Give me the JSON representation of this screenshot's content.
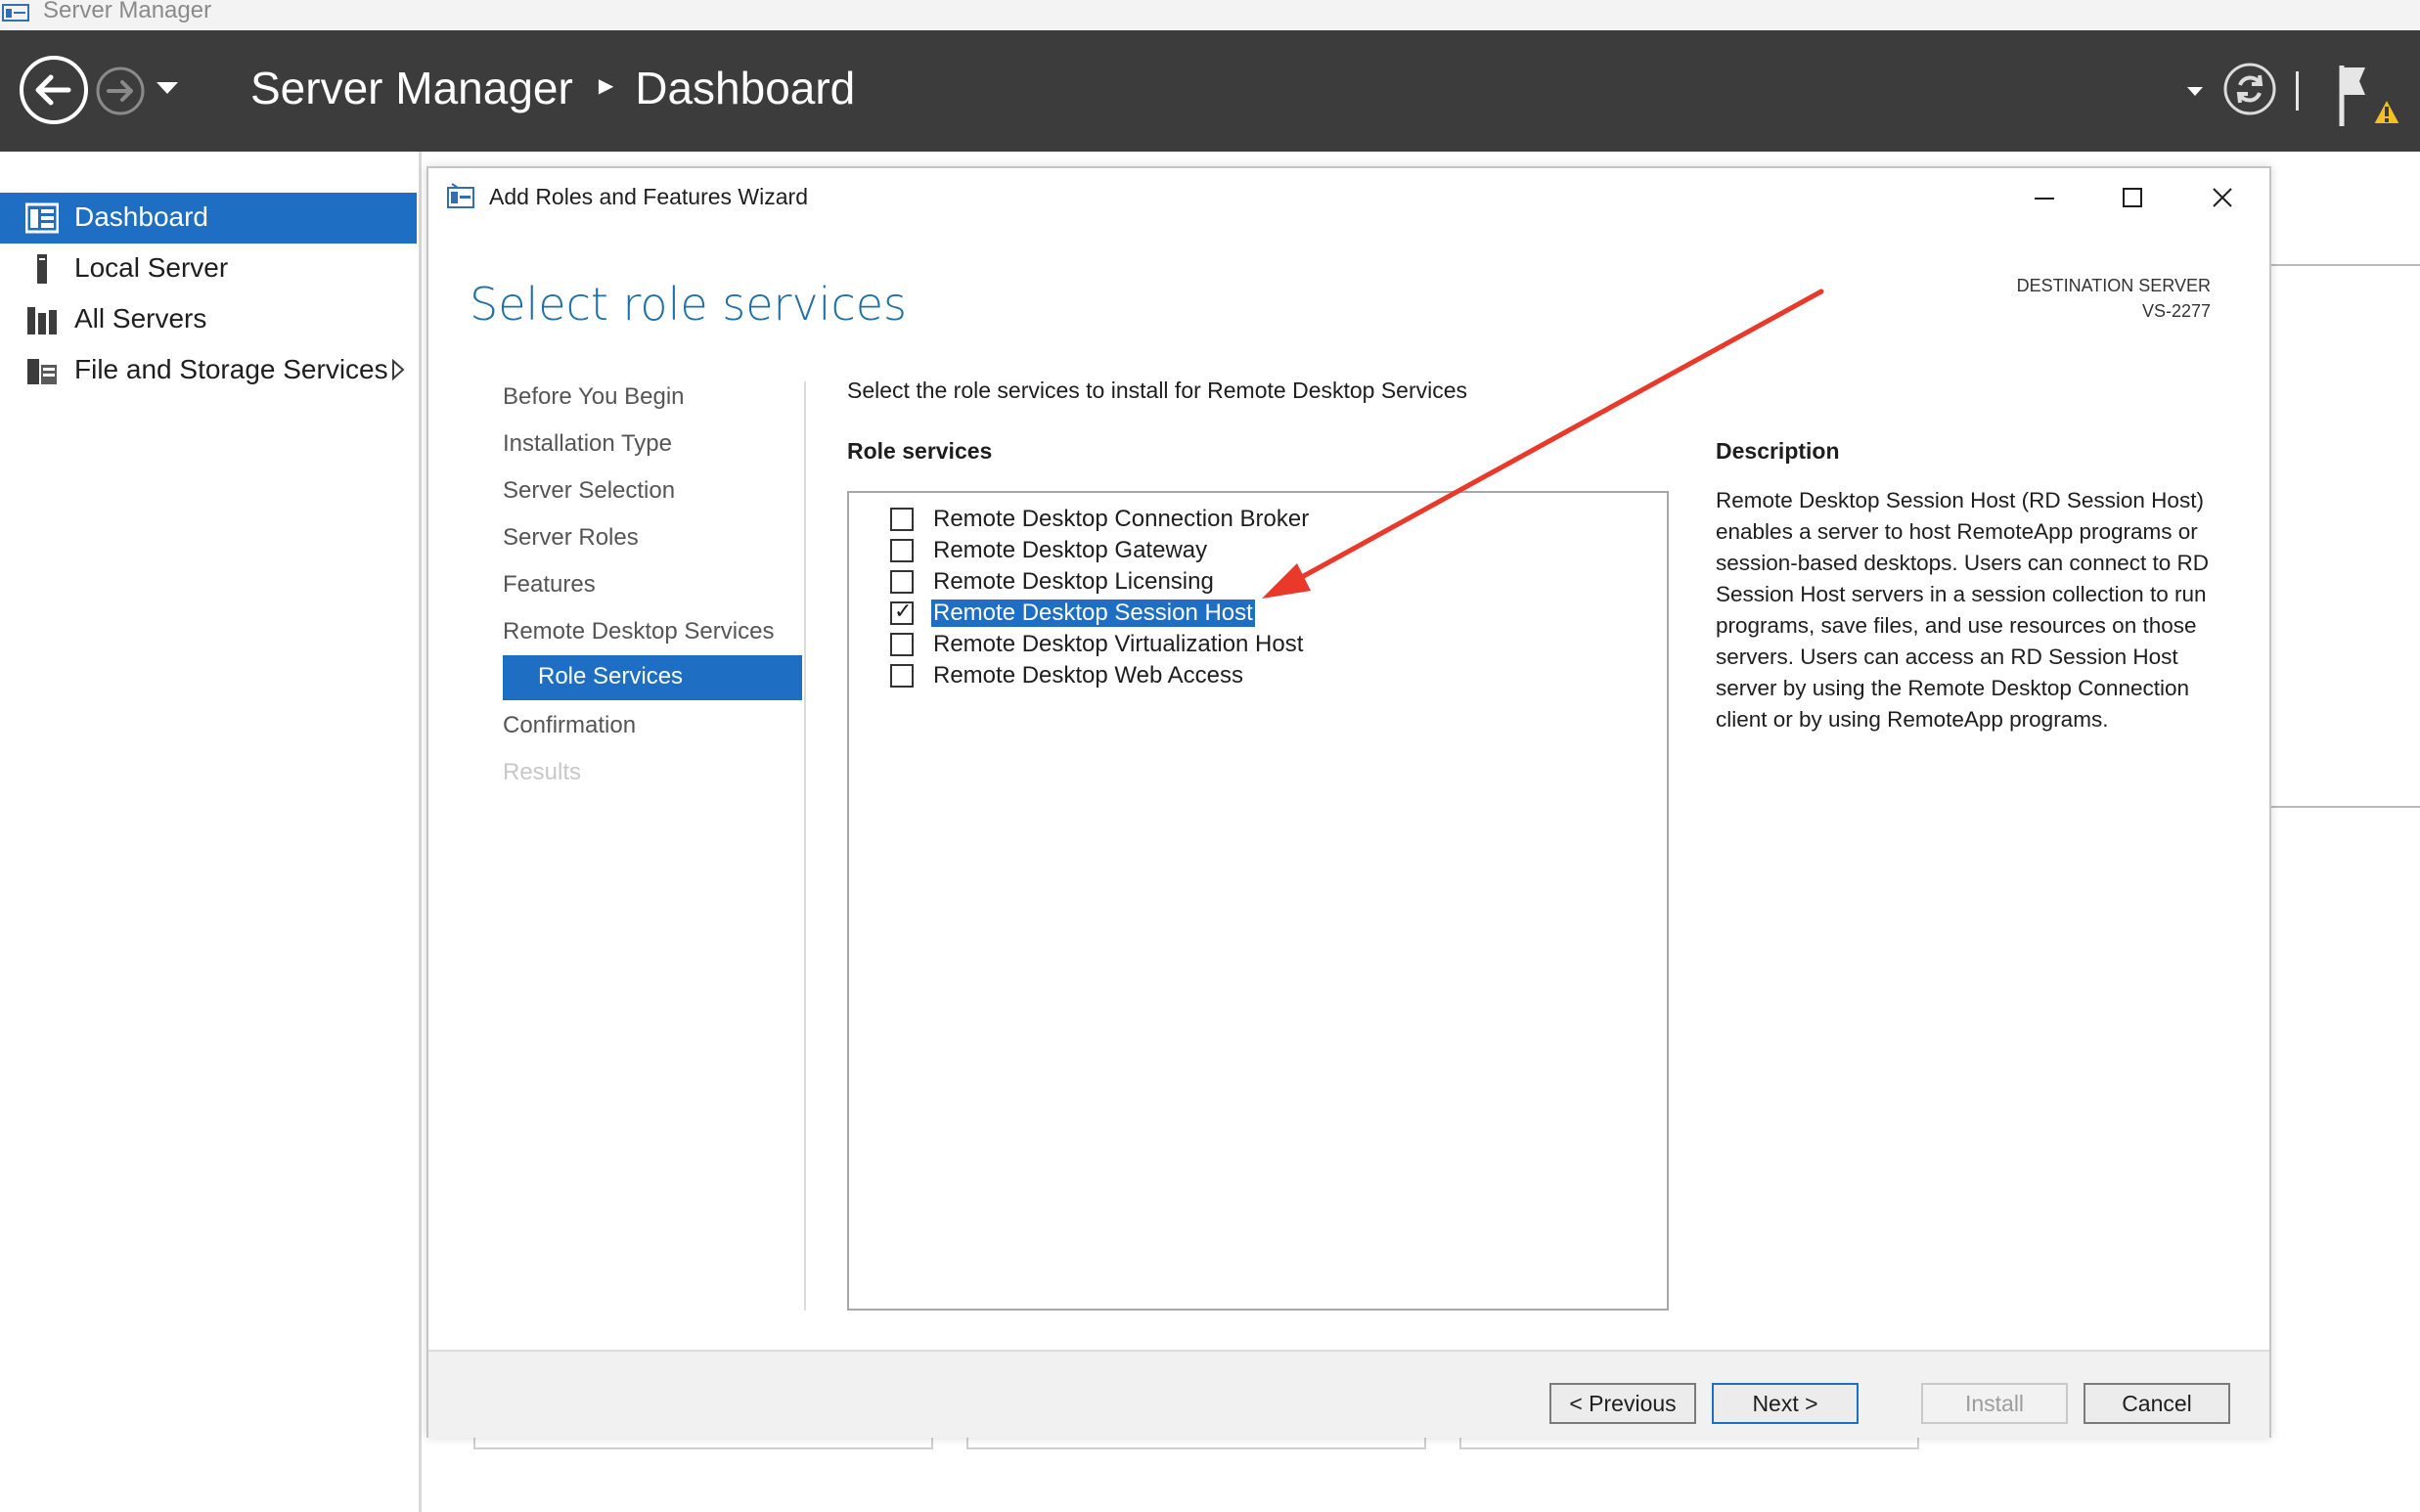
{
  "window": {
    "title": "Server Manager"
  },
  "header": {
    "app": "Server Manager",
    "page": "Dashboard"
  },
  "sidebar": {
    "items": [
      {
        "label": "Dashboard",
        "icon": "dashboard-icon",
        "active": true
      },
      {
        "label": "Local Server",
        "icon": "server-icon"
      },
      {
        "label": "All Servers",
        "icon": "servers-icon"
      },
      {
        "label": "File and Storage Services",
        "icon": "storage-icon"
      }
    ]
  },
  "wizard": {
    "title": "Add Roles and Features Wizard",
    "page_title": "Select role services",
    "destination_label": "DESTINATION SERVER",
    "destination_value": "VS-2277",
    "steps": [
      {
        "label": "Before You Begin"
      },
      {
        "label": "Installation Type"
      },
      {
        "label": "Server Selection"
      },
      {
        "label": "Server Roles"
      },
      {
        "label": "Features"
      },
      {
        "label": "Remote Desktop Services"
      },
      {
        "label": "Role Services",
        "current": true
      },
      {
        "label": "Confirmation"
      },
      {
        "label": "Results",
        "disabled": true
      }
    ],
    "instruction": "Select the role services to install for Remote Desktop Services",
    "role_services_heading": "Role services",
    "role_services": [
      {
        "label": "Remote Desktop Connection Broker",
        "checked": false
      },
      {
        "label": "Remote Desktop Gateway",
        "checked": false
      },
      {
        "label": "Remote Desktop Licensing",
        "checked": false
      },
      {
        "label": "Remote Desktop Session Host",
        "checked": true,
        "selected": true
      },
      {
        "label": "Remote Desktop Virtualization Host",
        "checked": false
      },
      {
        "label": "Remote Desktop Web Access",
        "checked": false
      }
    ],
    "description_heading": "Description",
    "description": "Remote Desktop Session Host (RD Session Host) enables a server to host RemoteApp programs or session-based desktops. Users can connect to RD Session Host servers in a session collection to run programs, save files, and use resources on those servers. Users can access an RD Session Host server by using the Remote Desktop Connection client or by using RemoteApp programs.",
    "buttons": {
      "previous": "< Previous",
      "next": "Next >",
      "install": "Install",
      "cancel": "Cancel"
    }
  },
  "colors": {
    "header_bg": "#3c3c3c",
    "accent": "#1e6fc4",
    "title_blue": "#1f6fa8",
    "annotation_arrow": "#e8392a"
  }
}
